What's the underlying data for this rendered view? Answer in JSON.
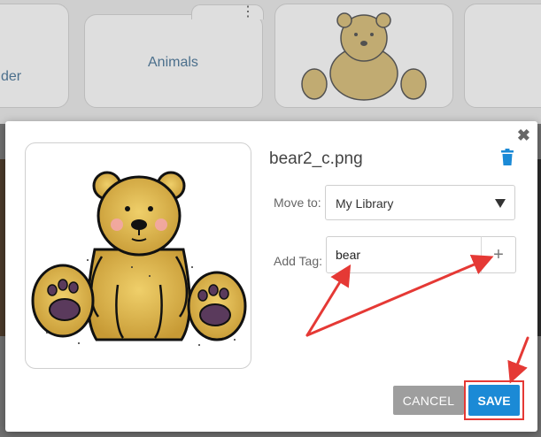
{
  "background": {
    "tiles": [
      {
        "label": "der"
      },
      {
        "label": "Animals"
      },
      {
        "label": ""
      },
      {
        "label": ""
      }
    ]
  },
  "dialog": {
    "filename": "bear2_c.png",
    "move_to": {
      "label": "Move to:",
      "value": "My Library"
    },
    "add_tag": {
      "label": "Add Tag:",
      "value": "bear",
      "add_symbol": "+"
    },
    "buttons": {
      "cancel": "CANCEL",
      "save": "SAVE"
    },
    "close_symbol": "✖",
    "icons": {
      "delete": "trash-icon",
      "close": "close-icon",
      "select": "caret-down-icon"
    }
  },
  "colors": {
    "accent": "#1b8ad6",
    "cancel": "#9e9e9e",
    "annotation": "#e53935",
    "folder_text": "#4b6f8c"
  }
}
